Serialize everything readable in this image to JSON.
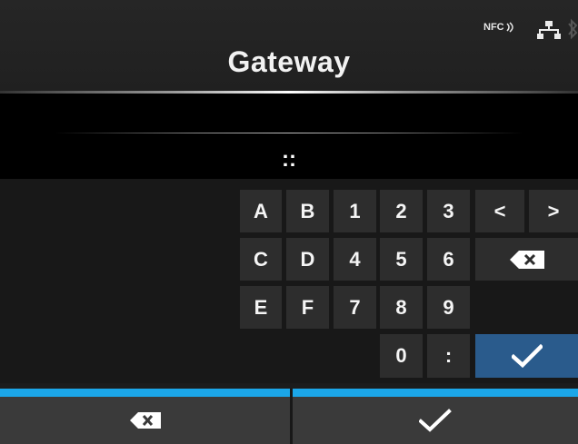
{
  "screen": {
    "title": "Gateway",
    "input_value": "::"
  },
  "status_bar": {
    "nfc_label": "NFC",
    "icons": [
      "nfc-icon",
      "network-icon",
      "bluetooth-icon"
    ]
  },
  "keypad": {
    "keys": [
      "A",
      "B",
      "1",
      "2",
      "3",
      "<",
      ">",
      "C",
      "D",
      "4",
      "5",
      "6",
      "backspace",
      "E",
      "F",
      "7",
      "8",
      "9",
      "0",
      ":",
      "enter"
    ],
    "rows": [
      [
        "A",
        "B",
        "1",
        "2",
        "3",
        "<",
        ">"
      ],
      [
        "C",
        "D",
        "4",
        "5",
        "6",
        "backspace"
      ],
      [
        "E",
        "F",
        "7",
        "8",
        "9"
      ],
      [
        "0",
        ":",
        "enter"
      ]
    ]
  },
  "softkeys": {
    "left": "backspace-icon",
    "right": "check-icon"
  },
  "colors": {
    "background": "#1c1c1c",
    "input_background": "#000000",
    "key": "#2d2d2d",
    "enter_key": "#2a5b8c",
    "softkey_accent": "#1ba6e8",
    "softkey": "#3a3a3a"
  }
}
